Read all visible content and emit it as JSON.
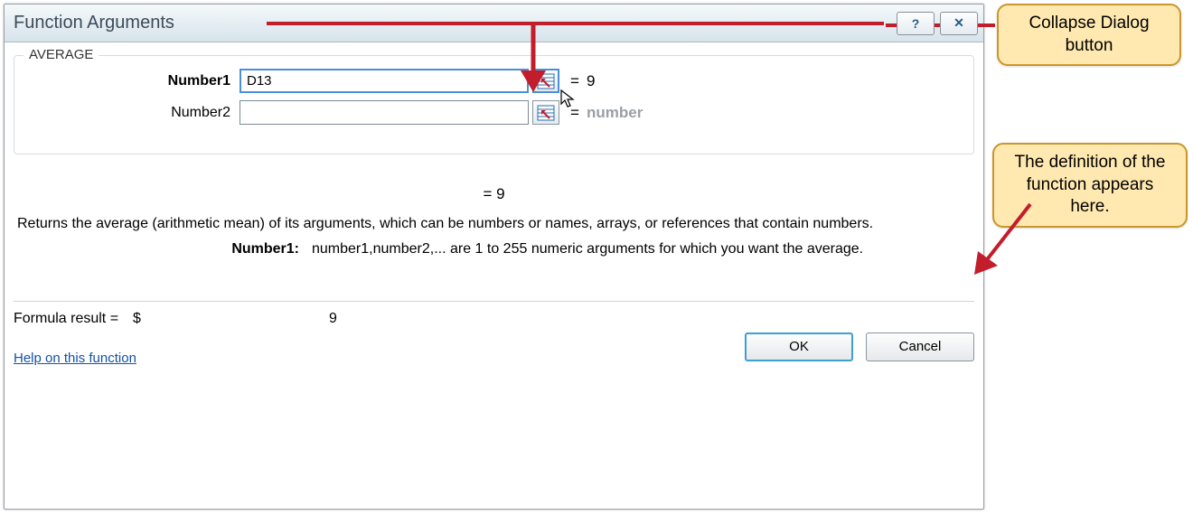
{
  "dialog": {
    "title": "Function Arguments",
    "function_name": "AVERAGE",
    "args": [
      {
        "label": "Number1",
        "value": "D13",
        "result": "9",
        "bold": true,
        "highlighted": true
      },
      {
        "label": "Number2",
        "value": "",
        "result": "number",
        "bold": false,
        "highlighted": false
      }
    ],
    "mid_result": "=   9",
    "description": "Returns the average (arithmetic mean) of its arguments, which can be numbers or names, arrays, or references that contain numbers.",
    "arg_help_label": "Number1:",
    "arg_help_text": "number1,number2,... are 1 to 255 numeric arguments for which you want the average.",
    "formula_result_label": "Formula result =",
    "formula_result_currency": "$",
    "formula_result_value": "9",
    "help_link": "Help on this function",
    "buttons": {
      "ok": "OK",
      "cancel": "Cancel"
    },
    "titlebar_help_glyph": "?",
    "titlebar_close_glyph": "✕"
  },
  "callouts": {
    "c1": "Collapse Dialog button",
    "c2": "The definition of the function appears here."
  }
}
